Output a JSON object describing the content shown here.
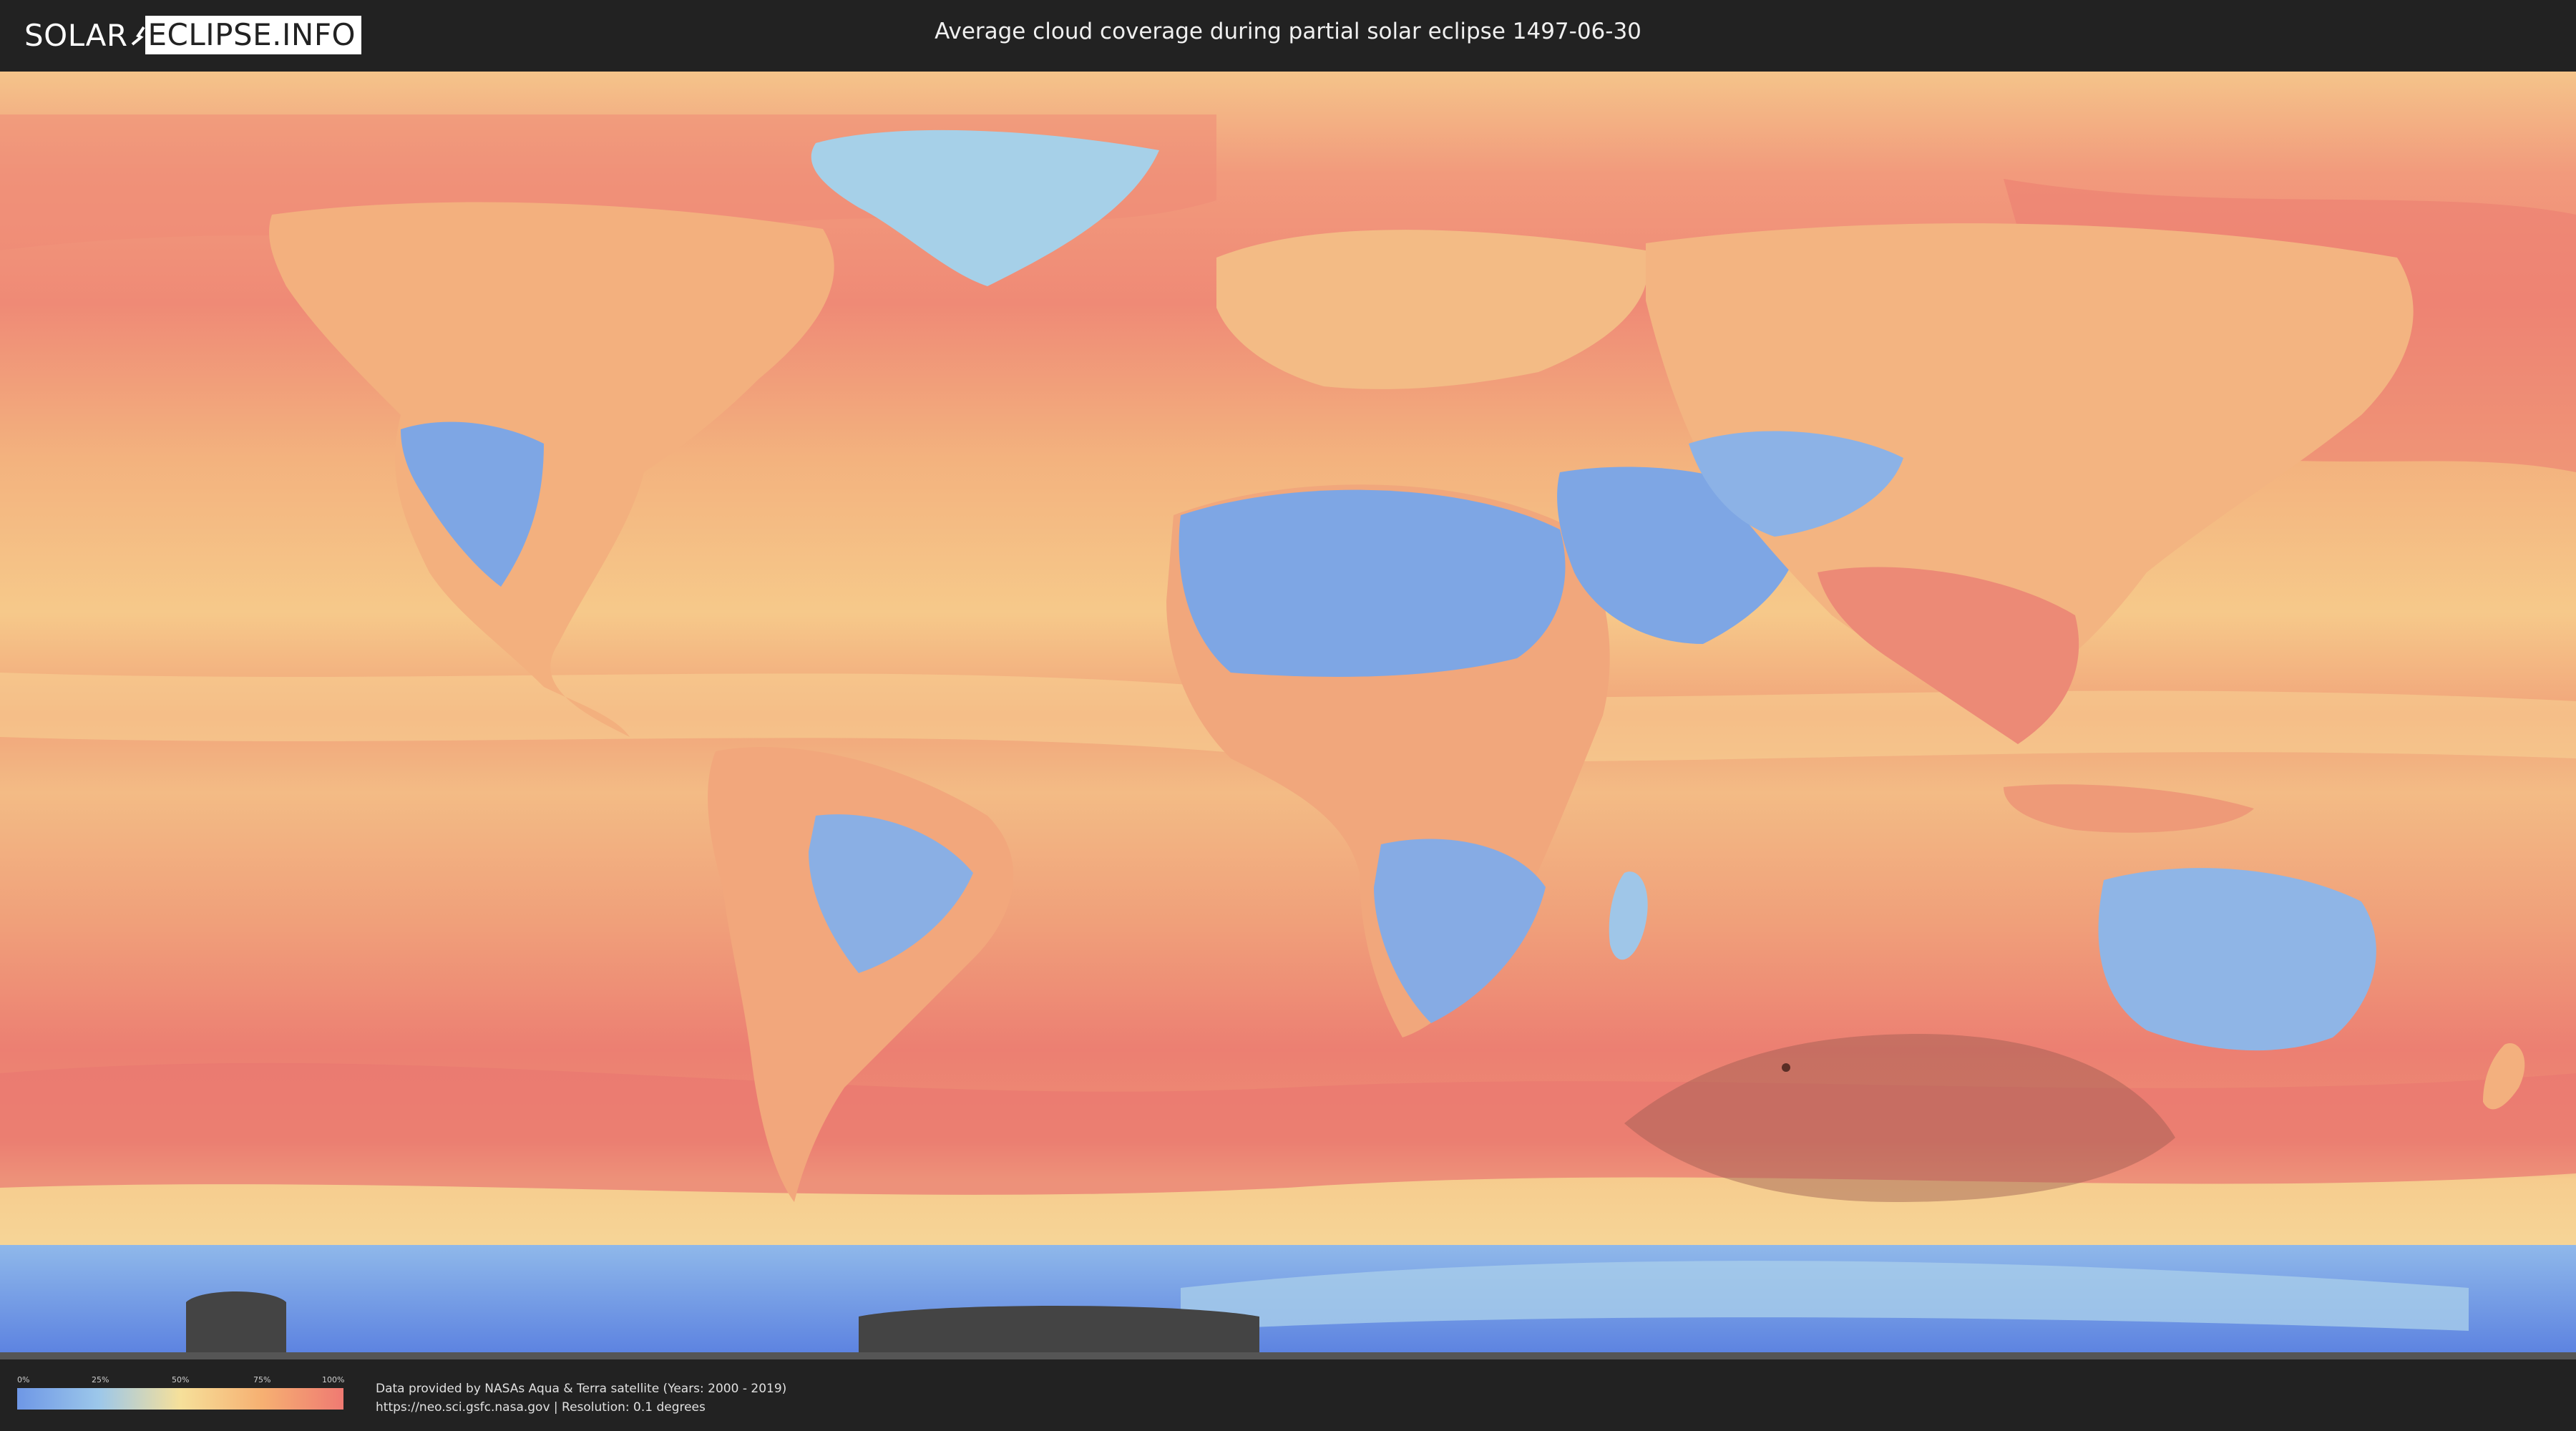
{
  "header": {
    "logo_part1": "SOLAR",
    "logo_part2": "ECLIPSE.INFO",
    "title": "Average cloud coverage during partial solar eclipse 1497-06-30"
  },
  "legend": {
    "ticks": [
      "0%",
      "25%",
      "50%",
      "75%",
      "100%"
    ],
    "colors": [
      "#6e97e6",
      "#9cc7ea",
      "#f6e09a",
      "#f6b072",
      "#ef7a72"
    ]
  },
  "footer": {
    "credit_line1": "Data provided by NASAs Aqua & Terra satellite (Years: 2000 - 2019)",
    "credit_line2": "https://neo.sci.gsfc.nasa.gov | Resolution: 0.1 degrees"
  },
  "map": {
    "ocean_color": "#ef8f78",
    "eclipse_zone_color": "#9b5a50"
  }
}
